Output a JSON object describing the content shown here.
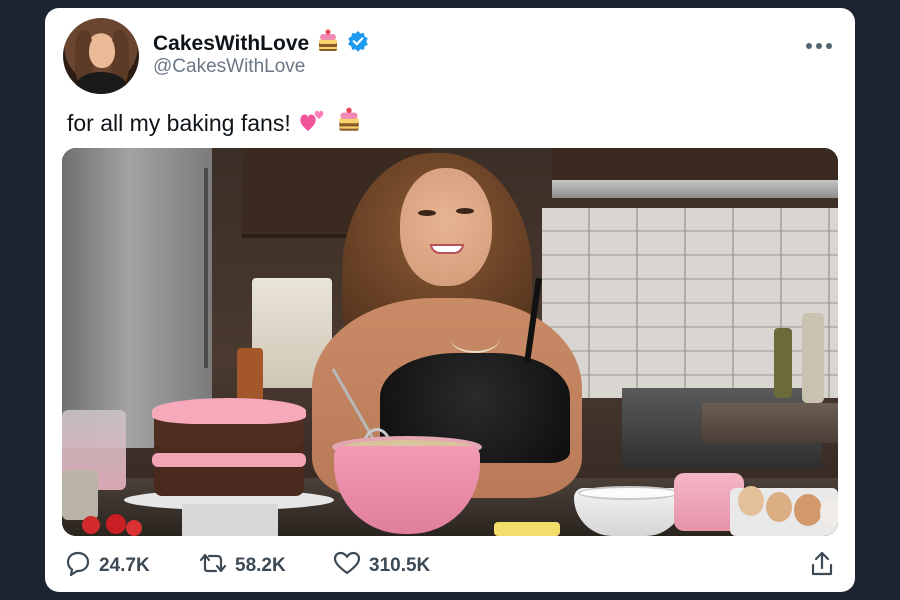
{
  "post": {
    "display_name": "CakesWithLove",
    "handle": "@CakesWithLove",
    "text": "for all my baking fans!",
    "more_icon": "more-icon"
  },
  "stats": {
    "replies": "24.7K",
    "reposts": "58.2K",
    "likes": "310.5K"
  },
  "colors": {
    "verified": "#1d9bf0",
    "text": "#0f1419",
    "muted": "#536471",
    "background": "#1b2430"
  },
  "icons": [
    "cake-emoji-icon",
    "verified-badge-icon",
    "two-hearts-icon",
    "reply-icon",
    "repost-icon",
    "like-icon",
    "share-icon"
  ]
}
